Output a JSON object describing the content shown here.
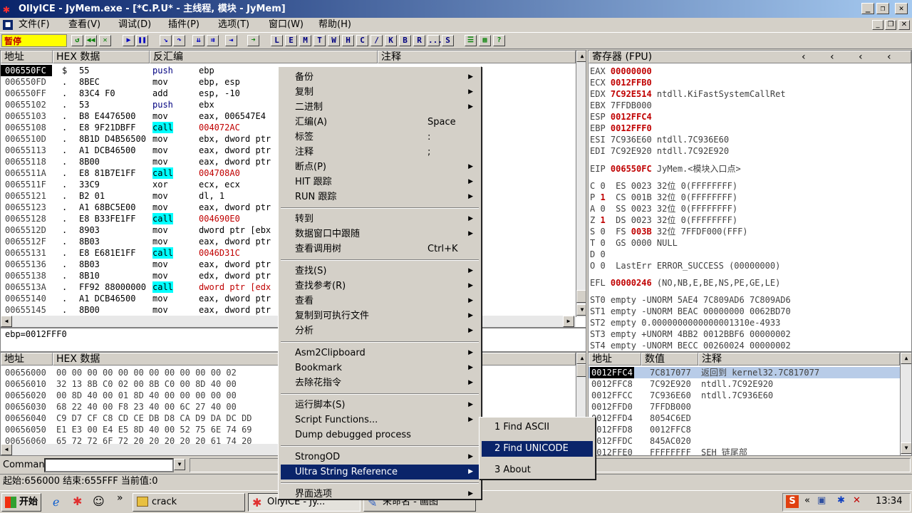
{
  "window": {
    "title": "OllyICE - JyMem.exe - [*C.P.U* -  主线程, 模块 - JyMem]"
  },
  "menu": [
    "文件(F)",
    "查看(V)",
    "调试(D)",
    "插件(P)",
    "选项(T)",
    "窗口(W)",
    "帮助(H)"
  ],
  "toolbar": {
    "status": "暂停",
    "letters": [
      "L",
      "E",
      "M",
      "T",
      "W",
      "H",
      "C",
      "/",
      "K",
      "B",
      "R",
      "...",
      "S"
    ]
  },
  "disasm": {
    "headers": {
      "addr": "地址",
      "hex": "HEX 数据",
      "dis": "反汇编",
      "comment": "注释"
    },
    "rows": [
      {
        "a": "006550FC",
        "m": "$",
        "h": "55",
        "op": "push",
        "arg": "ebp",
        "call": false,
        "sel": true
      },
      {
        "a": "006550FD",
        "m": ".",
        "h": "8BEC",
        "op": "mov",
        "arg": "ebp, esp",
        "call": false
      },
      {
        "a": "006550FF",
        "m": ".",
        "h": "83C4 F0",
        "op": "add",
        "arg": "esp, -10",
        "call": false
      },
      {
        "a": "00655102",
        "m": ".",
        "h": "53",
        "op": "push",
        "arg": "ebx",
        "call": false
      },
      {
        "a": "00655103",
        "m": ".",
        "h": "B8 E4476500",
        "op": "mov",
        "arg": "eax, 006547E4",
        "call": false
      },
      {
        "a": "00655108",
        "m": ".",
        "h": "E8 9F21DBFF",
        "op": "call",
        "arg": "004072AC",
        "call": true
      },
      {
        "a": "0065510D",
        "m": ".",
        "h": "8B1D D4B56500",
        "op": "mov",
        "arg": "ebx, dword ptr",
        "call": false
      },
      {
        "a": "00655113",
        "m": ".",
        "h": "A1 DCB46500",
        "op": "mov",
        "arg": "eax, dword ptr",
        "call": false
      },
      {
        "a": "00655118",
        "m": ".",
        "h": "8B00",
        "op": "mov",
        "arg": "eax, dword ptr",
        "call": false
      },
      {
        "a": "0065511A",
        "m": ".",
        "h": "E8 81B7E1FF",
        "op": "call",
        "arg": "004708A0",
        "call": true
      },
      {
        "a": "0065511F",
        "m": ".",
        "h": "33C9",
        "op": "xor",
        "arg": "ecx, ecx",
        "call": false
      },
      {
        "a": "00655121",
        "m": ".",
        "h": "B2 01",
        "op": "mov",
        "arg": "dl, 1",
        "call": false
      },
      {
        "a": "00655123",
        "m": ".",
        "h": "A1 68BC5E00",
        "op": "mov",
        "arg": "eax, dword ptr",
        "call": false
      },
      {
        "a": "00655128",
        "m": ".",
        "h": "E8 B33FE1FF",
        "op": "call",
        "arg": "004690E0",
        "call": true
      },
      {
        "a": "0065512D",
        "m": ".",
        "h": "8903",
        "op": "mov",
        "arg": "dword ptr [ebx",
        "call": false
      },
      {
        "a": "0065512F",
        "m": ".",
        "h": "8B03",
        "op": "mov",
        "arg": "eax, dword ptr",
        "call": false
      },
      {
        "a": "00655131",
        "m": ".",
        "h": "E8 E681E1FF",
        "op": "call",
        "arg": "0046D31C",
        "call": true
      },
      {
        "a": "00655136",
        "m": ".",
        "h": "8B03",
        "op": "mov",
        "arg": "eax, dword ptr",
        "call": false
      },
      {
        "a": "00655138",
        "m": ".",
        "h": "8B10",
        "op": "mov",
        "arg": "edx, dword ptr",
        "call": false
      },
      {
        "a": "0065513A",
        "m": ".",
        "h": "FF92 88000000",
        "op": "call",
        "arg": "dword ptr [edx",
        "call": true
      },
      {
        "a": "00655140",
        "m": ".",
        "h": "A1 DCB46500",
        "op": "mov",
        "arg": "eax, dword ptr",
        "call": false
      },
      {
        "a": "00655145",
        "m": ".",
        "h": "8B00",
        "op": "mov",
        "arg": "eax, dword ptr",
        "call": false
      }
    ],
    "info": "ebp=0012FFF0"
  },
  "registers": {
    "title": "寄存器 (FPU)",
    "lines": [
      {
        "t": "EAX ",
        "v": "00000000",
        "r": ""
      },
      {
        "t": "ECX ",
        "v": "0012FFB0",
        "r": ""
      },
      {
        "t": "EDX ",
        "v": "7C92E514",
        "r": " ntdll.KiFastSystemCallRet"
      },
      {
        "t": "EBX 7FFDB000",
        "v": "",
        "r": ""
      },
      {
        "t": "ESP ",
        "v": "0012FFC4",
        "r": ""
      },
      {
        "t": "EBP ",
        "v": "0012FFF0",
        "r": ""
      },
      {
        "t": "ESI 7C936E60 ntdll.7C936E60",
        "v": "",
        "r": ""
      },
      {
        "t": "EDI 7C92E920 ntdll.7C92E920",
        "v": "",
        "r": ""
      },
      {
        "t": "",
        "v": "",
        "r": ""
      },
      {
        "t": "EIP ",
        "v": "006550FC",
        "r": " JyMem.<模块入口点>"
      },
      {
        "t": "",
        "v": "",
        "r": ""
      },
      {
        "t": "C 0  ES 0023 32位 0(FFFFFFFF)",
        "v": "",
        "r": ""
      },
      {
        "t": "P ",
        "v": "1",
        "r": "  CS 001B 32位 0(FFFFFFFF)"
      },
      {
        "t": "A 0  SS 0023 32位 0(FFFFFFFF)",
        "v": "",
        "r": ""
      },
      {
        "t": "Z ",
        "v": "1",
        "r": "  DS 0023 32位 0(FFFFFFFF)"
      },
      {
        "t": "S 0  FS ",
        "v": "003B",
        "r": " 32位 7FFDF000(FFF)"
      },
      {
        "t": "T 0  GS 0000 NULL",
        "v": "",
        "r": ""
      },
      {
        "t": "D 0",
        "v": "",
        "r": ""
      },
      {
        "t": "O 0  LastErr ERROR_SUCCESS (00000000)",
        "v": "",
        "r": ""
      },
      {
        "t": "",
        "v": "",
        "r": ""
      },
      {
        "t": "EFL ",
        "v": "00000246",
        "r": " (NO,NB,E,BE,NS,PE,GE,LE)"
      },
      {
        "t": "",
        "v": "",
        "r": ""
      },
      {
        "t": "ST0 empty -UNORM 5AE4 7C809AD6 7C809AD6",
        "v": "",
        "r": ""
      },
      {
        "t": "ST1 empty -UNORM BEAC 00000000 0062BD70",
        "v": "",
        "r": ""
      },
      {
        "t": "ST2 empty 0.0000000000000001310e-4933",
        "v": "",
        "r": ""
      },
      {
        "t": "ST3 empty +UNORM 4BB2 0012BBF6 00000002",
        "v": "",
        "r": ""
      },
      {
        "t": "ST4 empty -UNORM BECC 00260024 00000002",
        "v": "",
        "r": ""
      }
    ]
  },
  "dump": {
    "headers": {
      "addr": "地址",
      "hex": "HEX 数据"
    },
    "rows": [
      {
        "a": "00656000",
        "h": "00 00 00 00 00 00 00 00 00 00 00 02"
      },
      {
        "a": "00656010",
        "h": "32 13 8B C0 02 00 8B C0 00 8D 40 00"
      },
      {
        "a": "00656020",
        "h": "00 8D 40 00 01 8D 40 00 00 00 00 00"
      },
      {
        "a": "00656030",
        "h": "68 22 40 00 F8 23 40 00 6C 27 40 00"
      },
      {
        "a": "00656040",
        "h": "C9 D7 CF C8 CD CE DB D8 CA D9 DA DC DD"
      },
      {
        "a": "00656050",
        "h": "E1 E3 00 E4 E5 8D 40 00 52 75 6E 74 69"
      },
      {
        "a": "00656060",
        "h": "65 72 72 6F 72 20 20 20 20 20 61 74 20"
      }
    ]
  },
  "stack": {
    "headers": {
      "addr": "地址",
      "val": "数值",
      "comment": "注释"
    },
    "rows": [
      {
        "a": "0012FFC4",
        "v": "7C817077",
        "c": "返回到 kernel32.7C817077",
        "sel": true
      },
      {
        "a": "0012FFC8",
        "v": "7C92E920",
        "c": "ntdll.7C92E920"
      },
      {
        "a": "0012FFCC",
        "v": "7C936E60",
        "c": "ntdll.7C936E60"
      },
      {
        "a": "0012FFD0",
        "v": "7FFDB000",
        "c": ""
      },
      {
        "a": "0012FFD4",
        "v": "8054C6ED",
        "c": ""
      },
      {
        "a": "0012FFD8",
        "v": "0012FFC8",
        "c": ""
      },
      {
        "a": "0012FFDC",
        "v": "845AC020",
        "c": ""
      },
      {
        "a": "0012FFE0",
        "v": "FFFFFFFF",
        "c": "SEH 链尾部"
      }
    ]
  },
  "context_menu": [
    {
      "label": "备份",
      "shortcut": "",
      "arrow": true
    },
    {
      "label": "复制",
      "shortcut": "",
      "arrow": true
    },
    {
      "label": "二进制",
      "shortcut": "",
      "arrow": true
    },
    {
      "label": "汇编(A)",
      "shortcut": "Space",
      "arrow": false
    },
    {
      "label": "标签",
      "shortcut": ":",
      "arrow": false
    },
    {
      "label": "注释",
      "shortcut": ";",
      "arrow": false
    },
    {
      "label": "断点(P)",
      "shortcut": "",
      "arrow": true
    },
    {
      "label": "HIT 跟踪",
      "shortcut": "",
      "arrow": true
    },
    {
      "label": "RUN 跟踪",
      "shortcut": "",
      "arrow": true
    },
    {
      "sep": true
    },
    {
      "label": "转到",
      "shortcut": "",
      "arrow": true
    },
    {
      "label": "数据窗口中跟随",
      "shortcut": "",
      "arrow": true
    },
    {
      "label": "查看调用树",
      "shortcut": "Ctrl+K",
      "arrow": false
    },
    {
      "sep": true
    },
    {
      "label": "查找(S)",
      "shortcut": "",
      "arrow": true
    },
    {
      "label": "查找参考(R)",
      "shortcut": "",
      "arrow": true
    },
    {
      "label": "查看",
      "shortcut": "",
      "arrow": true
    },
    {
      "label": "复制到可执行文件",
      "shortcut": "",
      "arrow": true
    },
    {
      "label": "分析",
      "shortcut": "",
      "arrow": true
    },
    {
      "sep": true
    },
    {
      "label": "Asm2Clipboard",
      "shortcut": "",
      "arrow": true
    },
    {
      "label": "Bookmark",
      "shortcut": "",
      "arrow": true
    },
    {
      "label": "去除花指令",
      "shortcut": "",
      "arrow": true
    },
    {
      "sep": true
    },
    {
      "label": "运行脚本(S)",
      "shortcut": "",
      "arrow": true
    },
    {
      "label": "Script Functions...",
      "shortcut": "",
      "arrow": true
    },
    {
      "label": "Dump debugged process",
      "shortcut": "",
      "arrow": false
    },
    {
      "sep": true
    },
    {
      "label": "StrongOD",
      "shortcut": "",
      "arrow": true
    },
    {
      "label": "Ultra String Reference",
      "shortcut": "",
      "arrow": true,
      "active": true
    },
    {
      "sep": true
    },
    {
      "label": "界面选项",
      "shortcut": "",
      "arrow": true
    }
  ],
  "submenu": [
    {
      "label": "1 Find ASCII"
    },
    {
      "label": "2 Find UNICODE",
      "active": true
    },
    {
      "label": "3 About"
    }
  ],
  "command": {
    "label": "Command",
    "value": ""
  },
  "status": {
    "text": "起始:656000 结束:655FFF 当前值:0"
  },
  "taskbar": {
    "start": "开始",
    "items": [
      "crack",
      "OllyICE - Jy...",
      "未命名 - 画图"
    ],
    "time": "13:34"
  },
  "colors": {
    "title_start": "#0a246a",
    "title_end": "#a6caf0",
    "selection": "#0a246a",
    "call_highlight": "#00ffff",
    "value_red": "#c00000"
  }
}
